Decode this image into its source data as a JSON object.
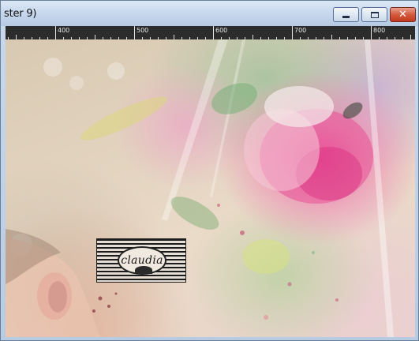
{
  "window": {
    "title": "ster 9)",
    "controls": {
      "minimize_icon": "minimize-icon",
      "maximize_icon": "maximize-icon",
      "close_icon": "close-icon",
      "close_glyph": "✕"
    }
  },
  "ruler": {
    "labels": [
      "400",
      "500",
      "600",
      "700",
      "800"
    ]
  },
  "canvas": {
    "watermark_text": "claudia"
  },
  "colors": {
    "titlebar": "#c3d5eb",
    "ruler_bg": "#2c2c2c",
    "close_button": "#d35a3e",
    "rose": "#e75499"
  }
}
